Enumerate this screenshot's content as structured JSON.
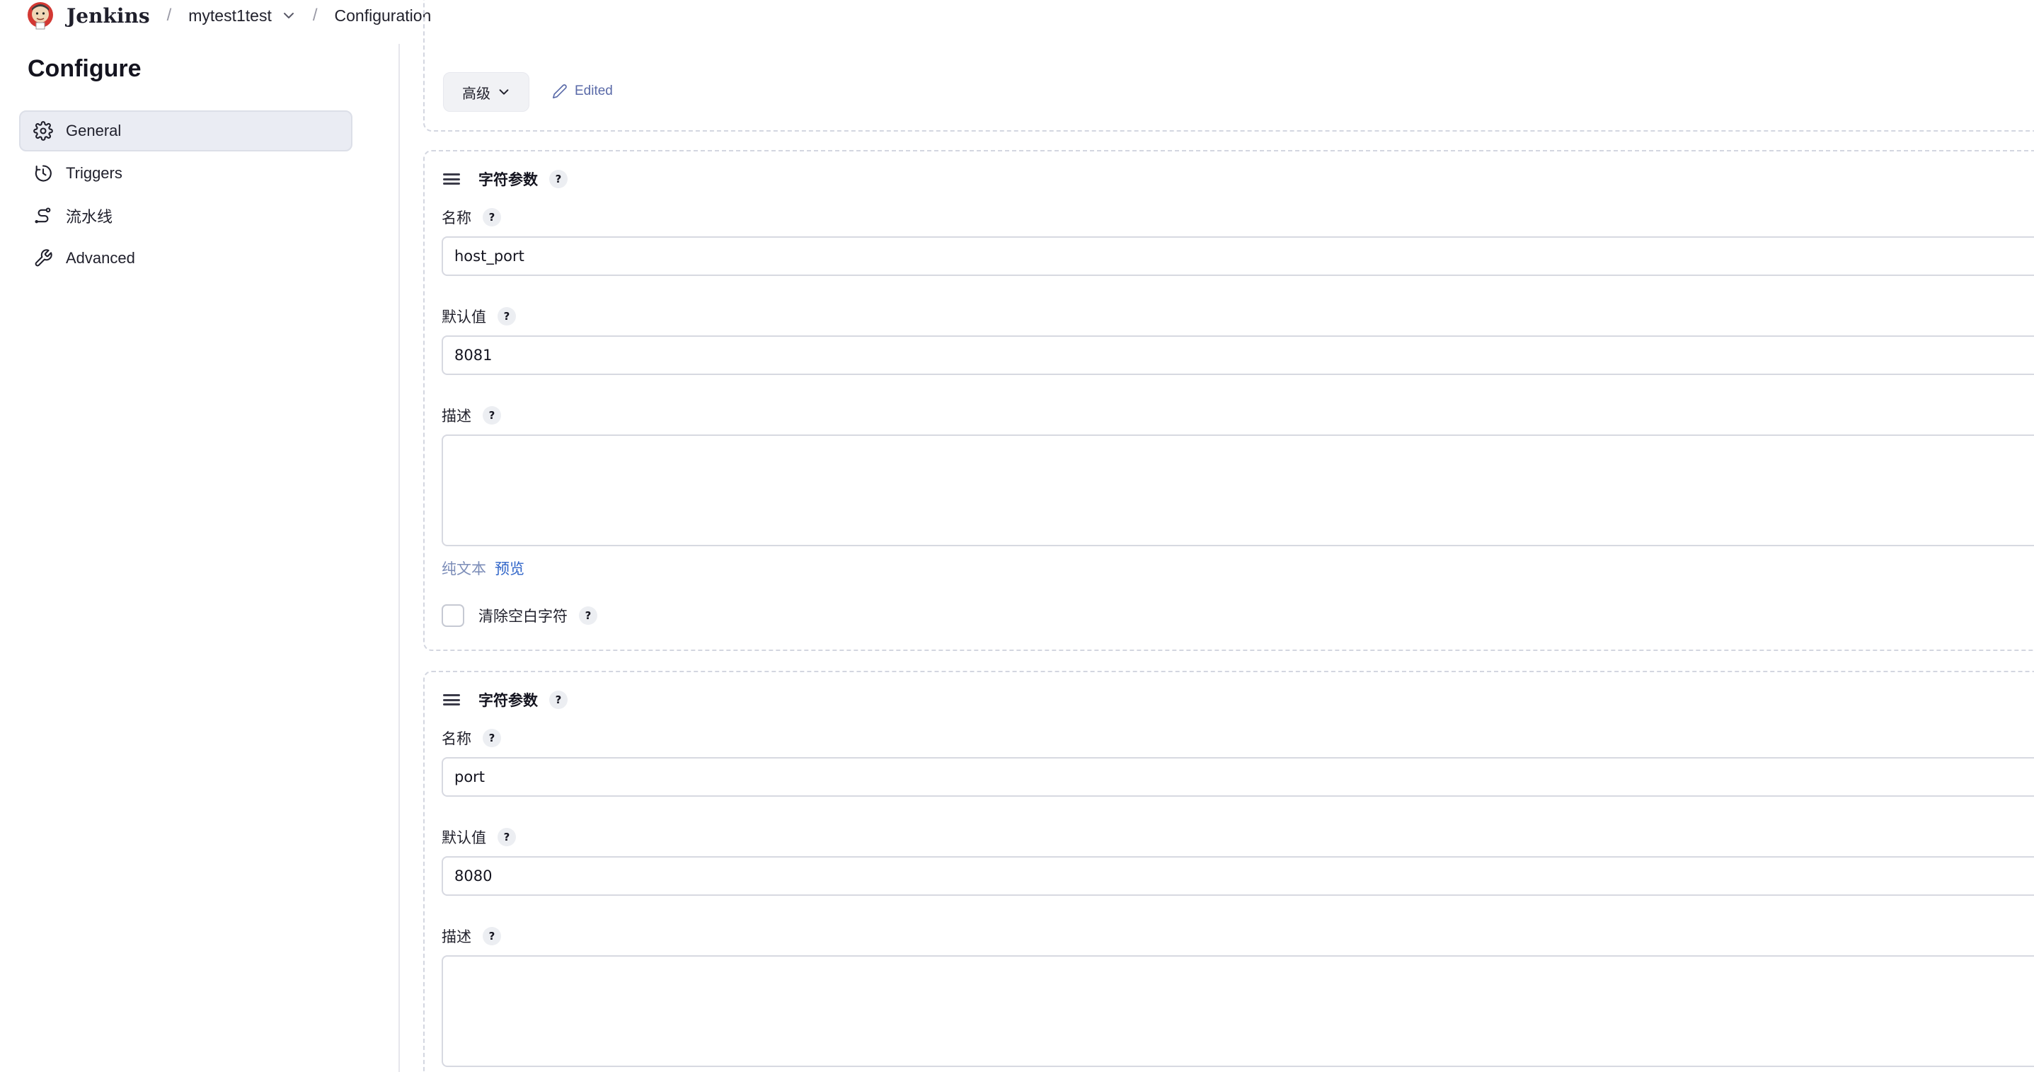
{
  "header": {
    "brand": "Jenkins",
    "breadcrumb": [
      {
        "label": "mytest1test"
      },
      {
        "label": "Configuration"
      }
    ],
    "separator": "/"
  },
  "sidebar": {
    "title": "Configure",
    "items": [
      {
        "label": "General",
        "icon": "gear-icon",
        "active": true
      },
      {
        "label": "Triggers",
        "icon": "clock-icon",
        "active": false
      },
      {
        "label": "流水线",
        "icon": "pipeline-icon",
        "active": false
      },
      {
        "label": "Advanced",
        "icon": "wrench-icon",
        "active": false
      }
    ]
  },
  "main": {
    "top_section": {
      "advanced_button": "高级",
      "edited_label": "Edited"
    },
    "parameters": [
      {
        "title": "字符参数",
        "name_label": "名称",
        "name_value": "host_port",
        "default_label": "默认值",
        "default_value": "8081",
        "description_label": "描述",
        "description_value": "",
        "plain_text_label": "纯文本",
        "preview_label": "预览",
        "trim_label": "清除空白字符"
      },
      {
        "title": "字符参数",
        "name_label": "名称",
        "name_value": "port",
        "default_label": "默认值",
        "default_value": "8080",
        "description_label": "描述",
        "description_value": ""
      }
    ],
    "help_glyph": "?"
  },
  "colors": {
    "accent_link": "#2f64c8",
    "muted_link": "#7c8db8",
    "active_nav_bg": "#eaecf3",
    "section_border": "#d3d6e0"
  }
}
